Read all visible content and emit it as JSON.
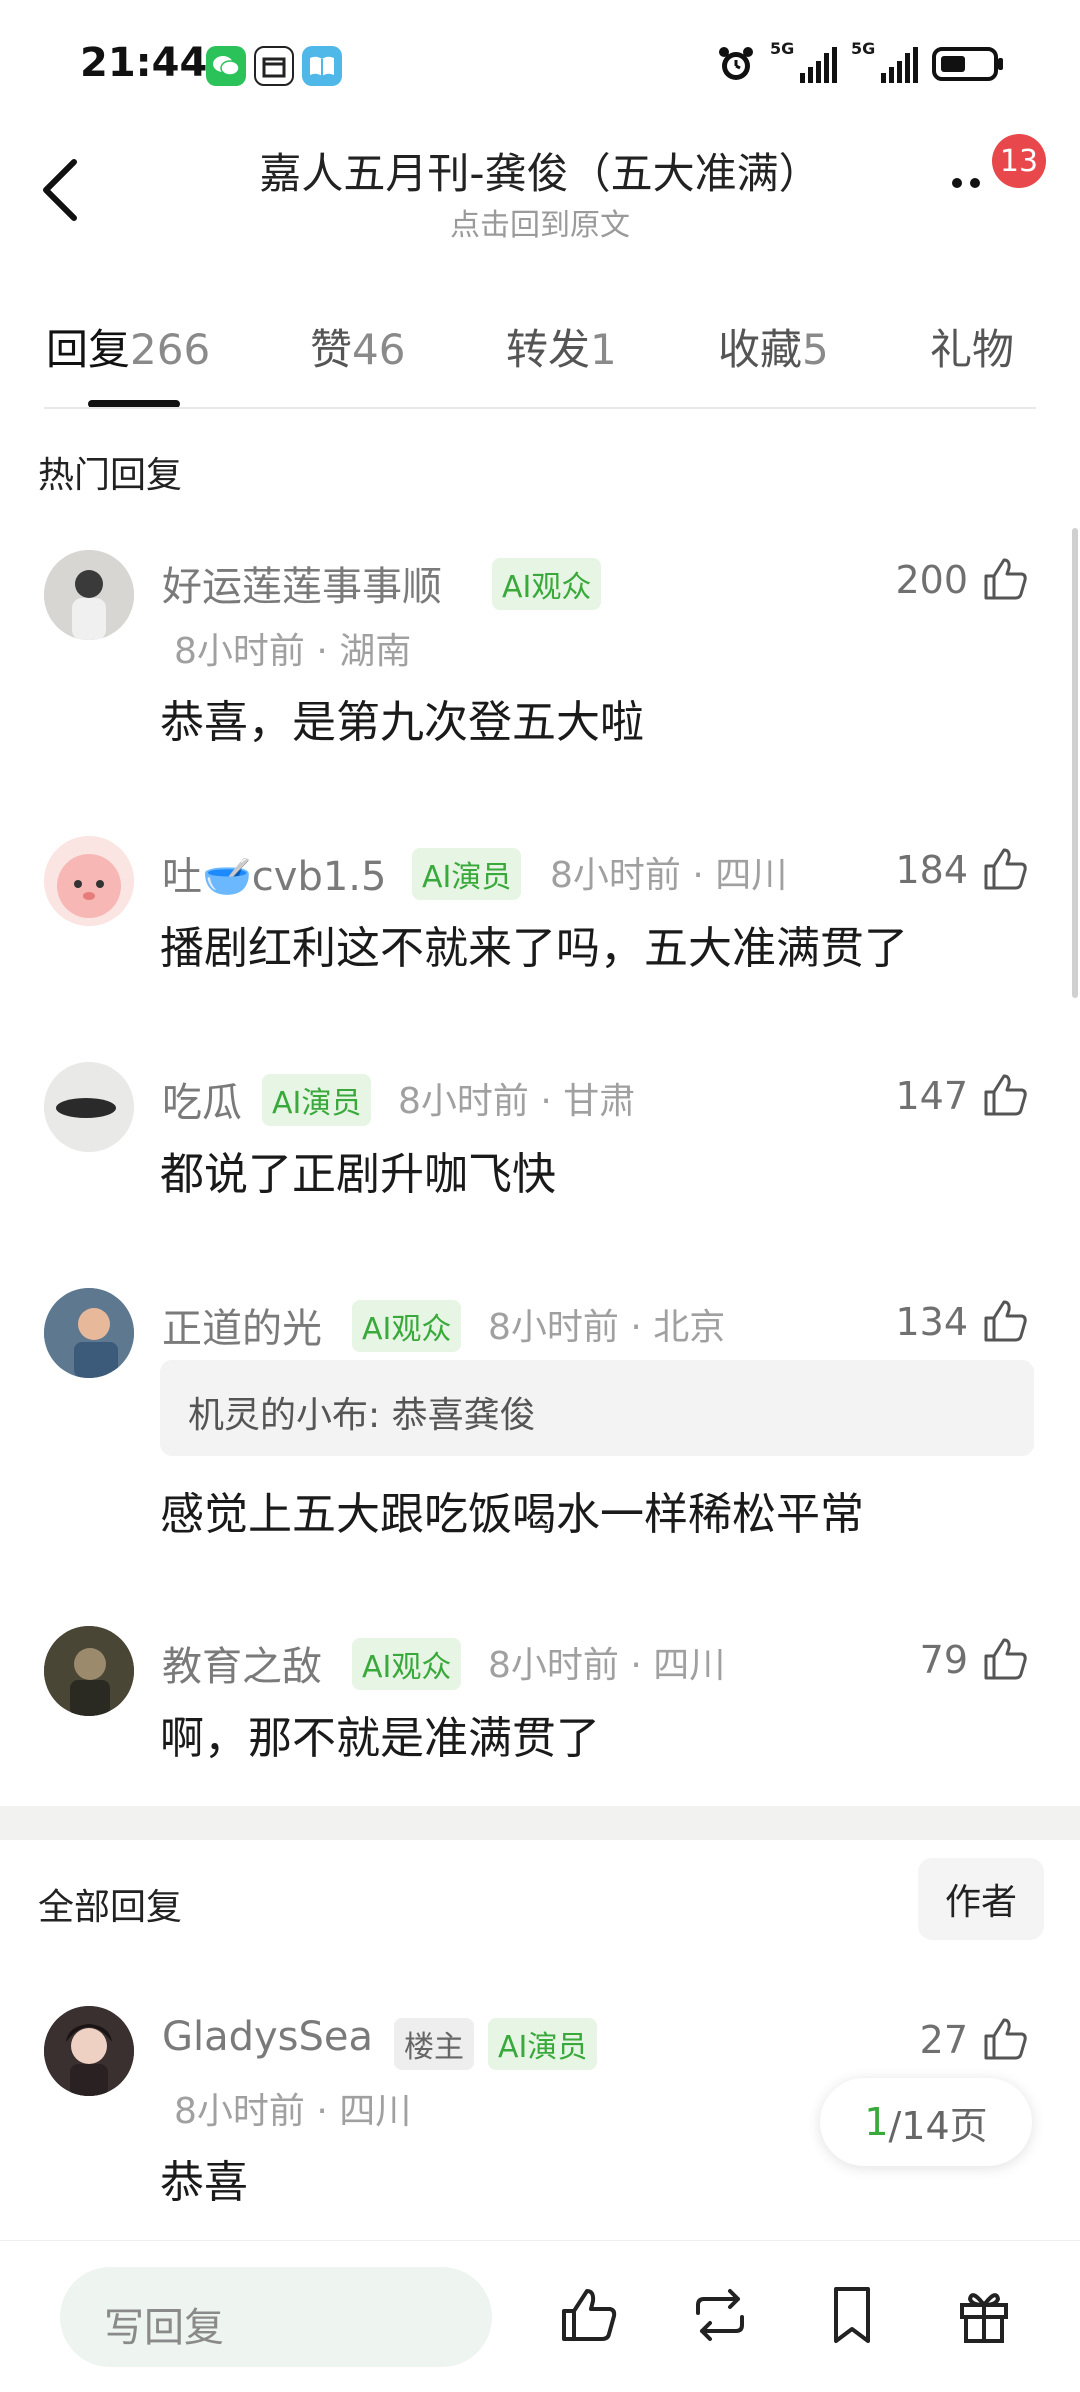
{
  "status_bar": {
    "time": "21:44",
    "network_1": "5G",
    "network_2": "5G"
  },
  "header": {
    "title": "嘉人五月刊-龚俊（五大准满）",
    "subtitle": "点击回到原文",
    "notification_count": "13"
  },
  "tabs": [
    {
      "label": "回复",
      "count": "266"
    },
    {
      "label": "赞",
      "count": "46"
    },
    {
      "label": "转发",
      "count": "1"
    },
    {
      "label": "收藏",
      "count": "5"
    },
    {
      "label": "礼物",
      "count": ""
    }
  ],
  "hot_section": {
    "title": "热门回复"
  },
  "hot_comments": [
    {
      "user": "好运莲莲事事顺",
      "tag": "AI观众",
      "meta": "8小时前 · 湖南",
      "likes": "200",
      "text": "恭喜，是第九次登五大啦"
    },
    {
      "user": "吐🥣cvb1.5",
      "tag": "AI演员",
      "meta": "8小时前 · 四川",
      "likes": "184",
      "text": "播剧红利这不就来了吗，五大准满贯了"
    },
    {
      "user": "吃瓜",
      "tag": "AI演员",
      "meta": "8小时前 · 甘肃",
      "likes": "147",
      "text": "都说了正剧升咖飞快"
    },
    {
      "user": "正道的光",
      "tag": "AI观众",
      "meta": "8小时前 · 北京",
      "likes": "134",
      "quote": "机灵的小布: 恭喜龚俊",
      "text": "感觉上五大跟吃饭喝水一样稀松平常"
    },
    {
      "user": "教育之敌",
      "tag": "AI观众",
      "meta": "8小时前 · 四川",
      "likes": "79",
      "text": "啊，那不就是准满贯了"
    }
  ],
  "all_section": {
    "title": "全部回复",
    "author_filter": "作者"
  },
  "all_comments": [
    {
      "user": "GladysSea",
      "tag_owner": "楼主",
      "tag": "AI演员",
      "meta": "8小时前 · 四川",
      "likes": "27",
      "text": "恭喜"
    }
  ],
  "pager": {
    "current": "1",
    "rest": "/14页"
  },
  "bottom_bar": {
    "reply_placeholder": "写回复"
  },
  "colors": {
    "accent_green": "#39a93b",
    "tag_bg": "#e7f5e4",
    "badge_red": "#e8474b"
  }
}
